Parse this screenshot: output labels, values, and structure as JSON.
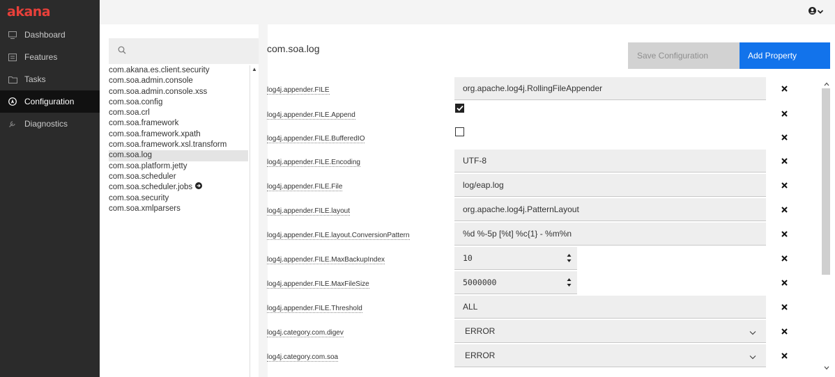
{
  "brand": {
    "logo_text": "akana",
    "accent": "#e8403a"
  },
  "sidebar": {
    "items": [
      {
        "label": "Dashboard",
        "icon": "monitor-icon",
        "active": false
      },
      {
        "label": "Features",
        "icon": "features-icon",
        "active": false
      },
      {
        "label": "Tasks",
        "icon": "folder-icon",
        "active": false
      },
      {
        "label": "Configuration",
        "icon": "compass-icon",
        "active": true
      },
      {
        "label": "Diagnostics",
        "icon": "wrench-icon",
        "active": false
      }
    ]
  },
  "topbar": {
    "user_icon": "user-icon",
    "dropdown_icon": "chevron-down-icon"
  },
  "search": {
    "placeholder": "",
    "icon": "search-icon"
  },
  "config_list": {
    "items": [
      "com.akana.es.client.security",
      "com.soa.admin.console",
      "com.soa.admin.console.xss",
      "com.soa.config",
      "com.soa.crl",
      "com.soa.framework",
      "com.soa.framework.xpath",
      "com.soa.framework.xsl.transform",
      "com.soa.log",
      "com.soa.platform.jetty",
      "com.soa.scheduler",
      "com.soa.scheduler.jobs",
      "com.soa.security",
      "com.soa.xmlparsers"
    ],
    "selected": "com.soa.log",
    "has_arrow": "com.soa.scheduler.jobs"
  },
  "header": {
    "title": "com.soa.log",
    "save_label": "Save Configuration",
    "add_label": "Add Property",
    "add_color": "#1273eb"
  },
  "properties": [
    {
      "label": "log4j.appender.FILE",
      "type": "text",
      "value": "org.apache.log4j.RollingFileAppender"
    },
    {
      "label": "log4j.appender.FILE.Append",
      "type": "checkbox",
      "checked": true
    },
    {
      "label": "log4j.appender.FILE.BufferedIO",
      "type": "checkbox",
      "checked": false
    },
    {
      "label": "log4j.appender.FILE.Encoding",
      "type": "text",
      "value": "UTF-8"
    },
    {
      "label": "log4j.appender.FILE.File",
      "type": "text",
      "value": "log/eap.log"
    },
    {
      "label": "log4j.appender.FILE.layout",
      "type": "text",
      "value": "org.apache.log4j.PatternLayout"
    },
    {
      "label": "log4j.appender.FILE.layout.ConversionPattern",
      "type": "text",
      "value": "%d %-5p [%t] %c{1} - %m%n"
    },
    {
      "label": "log4j.appender.FILE.MaxBackupIndex",
      "type": "number",
      "value": "10"
    },
    {
      "label": "log4j.appender.FILE.MaxFileSize",
      "type": "number",
      "value": "5000000"
    },
    {
      "label": "log4j.appender.FILE.Threshold",
      "type": "text",
      "value": "ALL"
    },
    {
      "label": "log4j.category.com.digev",
      "type": "select",
      "value": "ERROR"
    },
    {
      "label": "log4j.category.com.soa",
      "type": "select",
      "value": "ERROR"
    }
  ]
}
